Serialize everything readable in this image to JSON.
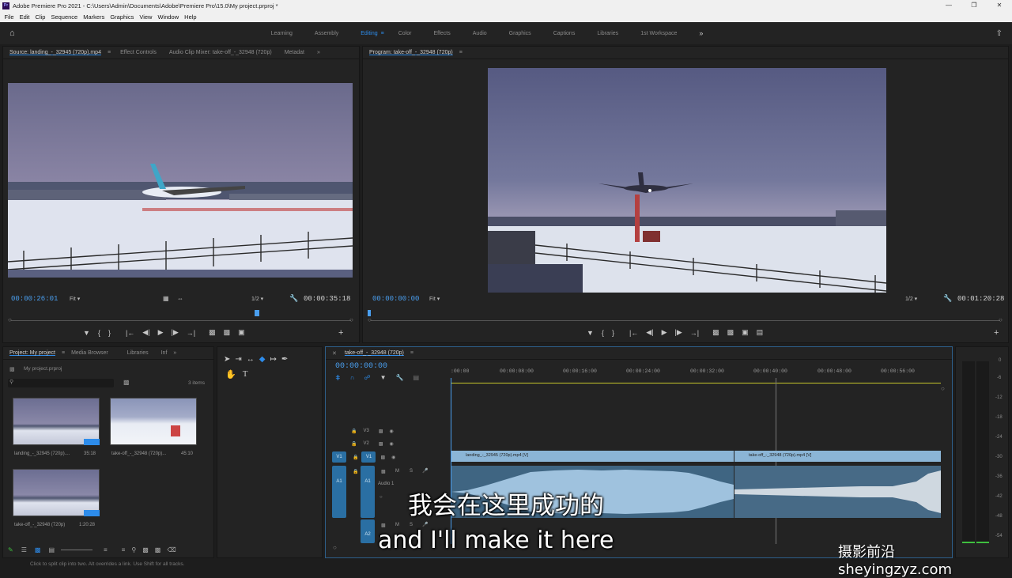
{
  "window": {
    "title": "Adobe Premiere Pro 2021 - C:\\Users\\Admin\\Documents\\Adobe\\Premiere Pro\\15.0\\My project.prproj *",
    "app_badge": "Pr"
  },
  "menu": [
    "File",
    "Edit",
    "Clip",
    "Sequence",
    "Markers",
    "Graphics",
    "View",
    "Window",
    "Help"
  ],
  "workspaces": [
    "Learning",
    "Assembly",
    "Editing",
    "Color",
    "Effects",
    "Audio",
    "Graphics",
    "Captions",
    "Libraries",
    "1st Workspace"
  ],
  "active_workspace": "Editing",
  "source": {
    "tabs": [
      "Source: landing_-_32945 (720p).mp4",
      "Effect Controls",
      "Audio Clip Mixer: take-off_-_32948 (720p)",
      "Metadat"
    ],
    "timecode": "00:00:26:01",
    "fit": "Fit",
    "resolution": "1/2",
    "duration": "00:00:35:18"
  },
  "program": {
    "tab": "Program: take-off_-_32948 (720p)",
    "timecode": "00:00:00:00",
    "fit": "Fit",
    "resolution": "1/2",
    "duration": "00:01:20:28"
  },
  "project": {
    "tabs": [
      "Project: My project",
      "Media Browser",
      "Libraries",
      "Inf"
    ],
    "file": "My project.prproj",
    "count": "3 items",
    "items": [
      {
        "name": "landing_-_32945 (720p)....",
        "duration": "35:18"
      },
      {
        "name": "take-off_-_32948 (720p)...",
        "duration": "45:10"
      },
      {
        "name": "take-off_-_32948 (720p)",
        "duration": "1:20:28"
      }
    ]
  },
  "timeline": {
    "tab": "take-off_-_32948 (720p)",
    "timecode": "00:00:00:00",
    "ruler": [
      ":00:00",
      "00:00:08:00",
      "00:00:16:00",
      "00:00:24:00",
      "00:00:32:00",
      "00:00:40:00",
      "00:00:48:00",
      "00:00:56:00"
    ],
    "tracks": {
      "v3": "V3",
      "v2": "V2",
      "v1": "V1",
      "a1": "A1",
      "a2": "A2",
      "audio_label": "Audio 1",
      "m": "M",
      "s": "S"
    },
    "clips": {
      "v1_a": "landing_-_32945 (720p).mp4 [V]",
      "v1_b": "take-off_-_32948 (720p).mp4 [V]"
    }
  },
  "meter": [
    "0",
    "-6",
    "-12",
    "-18",
    "-24",
    "-30",
    "-36",
    "-42",
    "-48",
    "-54"
  ],
  "subtitle": {
    "zh": "我会在这里成功的",
    "en": "and I'll make it here"
  },
  "watermark": "摄影前沿 sheyingzyz.com",
  "status": "Click to split clip into two. Alt overrides a link. Use Shift for all tracks.",
  "colors": {
    "accent": "#2d8ceb",
    "panel": "#232323"
  }
}
